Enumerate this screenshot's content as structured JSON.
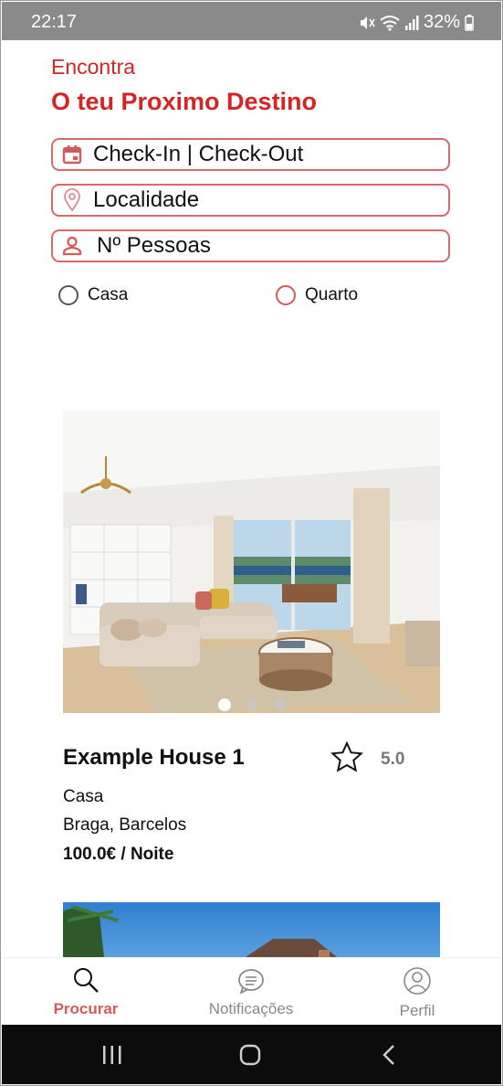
{
  "status_bar": {
    "time": "22:17",
    "battery": "32%"
  },
  "header": {
    "tagline": "Encontra",
    "title": "O teu Proximo Destino"
  },
  "search": {
    "dates_placeholder": "Check-In | Check-Out",
    "location_placeholder": "Localidade",
    "people_placeholder": "Nº Pessoas"
  },
  "filters": {
    "option_house": "Casa",
    "option_room": "Quarto"
  },
  "listings": [
    {
      "title": "Example House 1",
      "rating": "5.0",
      "type": "Casa",
      "location": "Braga, Barcelos",
      "price": "100.0€ / Noite",
      "image_slides": 3,
      "active_slide": 1
    }
  ],
  "bottom_nav": {
    "search_label": "Procurar",
    "notifications_label": "Notificações",
    "profile_label": "Perfil"
  },
  "colors": {
    "accent": "#d42424",
    "accent_soft": "#d86a6a",
    "muted": "#888888"
  },
  "icons": [
    "mute-icon",
    "wifi-icon",
    "signal-icon",
    "battery-icon",
    "calendar-icon",
    "location-pin-icon",
    "person-icon",
    "star-icon",
    "search-icon",
    "chat-icon",
    "profile-icon",
    "recent-apps-icon",
    "home-icon",
    "back-icon"
  ]
}
